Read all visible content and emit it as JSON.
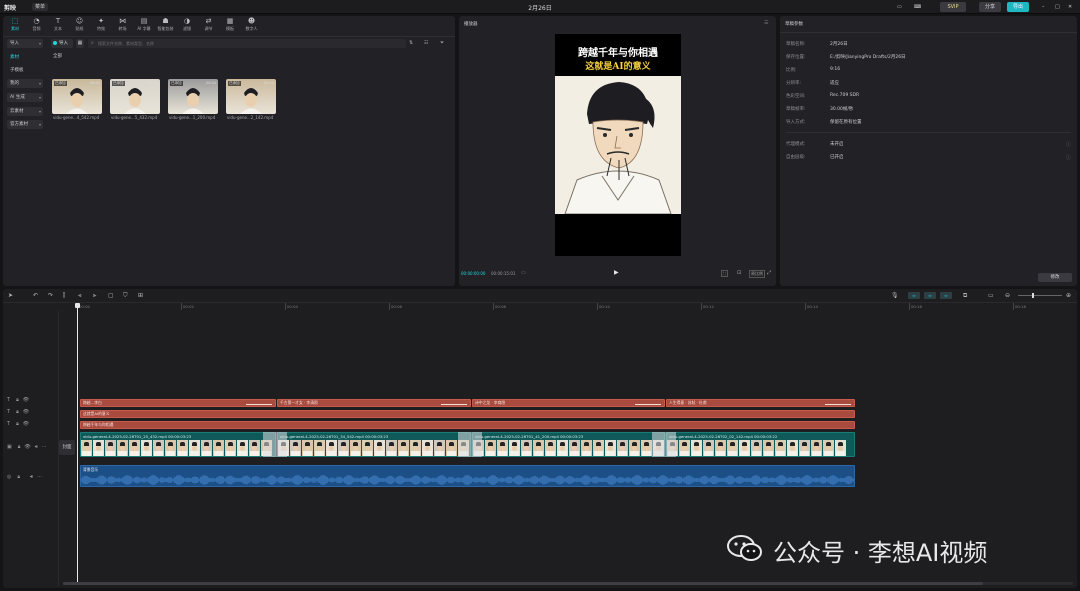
{
  "titlebar": {
    "app_name": "剪映",
    "menu_label": "菜单",
    "project_title": "2月26日",
    "vip_label": "SVIP",
    "share_label": "分享",
    "export_label": "导出"
  },
  "media": {
    "tools": [
      {
        "icon": "import-icon",
        "label": "素材"
      },
      {
        "icon": "audio-icon",
        "label": "音频"
      },
      {
        "icon": "text-icon",
        "label": "文本"
      },
      {
        "icon": "sticker-icon",
        "label": "贴纸"
      },
      {
        "icon": "effects-icon",
        "label": "特效"
      },
      {
        "icon": "transition-icon",
        "label": "转场"
      },
      {
        "icon": "ai-caption-icon",
        "label": "AI 字幕"
      },
      {
        "icon": "smart-package-icon",
        "label": "智能包装"
      },
      {
        "icon": "filter-icon",
        "label": "滤镜"
      },
      {
        "icon": "adjust-icon",
        "label": "调节"
      },
      {
        "icon": "template-icon",
        "label": "模板"
      },
      {
        "icon": "digital-human-icon",
        "label": "数字人"
      }
    ],
    "sidebar": [
      {
        "label": "导入",
        "caret": true,
        "sel": false
      },
      {
        "label": "素材",
        "caret": false,
        "sel": true
      },
      {
        "label": "子模板",
        "caret": false,
        "sel": false
      },
      {
        "label": "我的",
        "caret": true,
        "sel": false
      },
      {
        "label": "AI 生成",
        "caret": true,
        "sel": false
      },
      {
        "label": "云素材",
        "caret": true,
        "sel": false
      },
      {
        "label": "官方素材",
        "caret": true,
        "sel": false
      }
    ],
    "import_label": "导入",
    "search_placeholder": "搜索文件名称、素材类型、名称",
    "filter_all": "全部",
    "items": [
      {
        "badge": "已添加",
        "duration": "00:04",
        "name": "vidu-gene...4_542.mp4",
        "tone": "#c8b89a"
      },
      {
        "badge": "已添加",
        "duration": "00:04",
        "name": "vidu-gene...5_432.mp4",
        "tone": "#d9d4cc"
      },
      {
        "badge": "已添加",
        "duration": "00:04",
        "name": "vidu-gene...1_200.mp4",
        "tone": "#9b9b9b"
      },
      {
        "badge": "已添加",
        "duration": "00:04",
        "name": "vidu-gene...2_142.mp4",
        "tone": "#cbb99c"
      }
    ]
  },
  "player": {
    "header": "播放器",
    "caption_line1": "跨越千年与你相遇",
    "caption_line2": "这就是AI的意义",
    "current_time": "00:00:00:00",
    "total_time": "00:00:15:01",
    "ratio_btn": "原比例"
  },
  "props": {
    "header": "草稿参数",
    "rows": [
      {
        "k": "草稿名称:",
        "v": "2月26日"
      },
      {
        "k": "保存位置:",
        "v": "E:/剪映/JianyingPro Drafts/2月26日"
      },
      {
        "k": "比例:",
        "v": "9:16"
      },
      {
        "k": "分辨率:",
        "v": "适应"
      },
      {
        "k": "色彩空间:",
        "v": "Rec.709 SDR"
      },
      {
        "k": "草稿帧率:",
        "v": "30.00帧/秒"
      },
      {
        "k": "导入方式:",
        "v": "保留在原有位置"
      },
      {
        "k": "代理模式:",
        "v": "未开启"
      },
      {
        "k": "自由层级:",
        "v": "已开启"
      }
    ],
    "modify_button": "修改"
  },
  "timeline": {
    "ruler": [
      "00:00",
      "00:02",
      "00:04",
      "00:06",
      "00:08",
      "00:10",
      "00:12",
      "00:14",
      "00:16",
      "00:18"
    ],
    "cover_label": "封面",
    "text_clips_row1": [
      "跨越...李白",
      "千古第一才女 · 李清照",
      "诗中之龙 · 李商隐",
      "人生得意 · 苏轼 · 杜甫"
    ],
    "text_clip_row2": "这就是AI的意义",
    "text_clip_row3": "跨越千年与你相遇",
    "video_clips": [
      "vidu-general-4-2025-02-26T01_25_432.mp4   00:00:03:23",
      "vidu-general-4-2025-02-26T01_34_542.mp4   00:00:03:23",
      "vidu-general-4-2025-02-26T01_41_200.mp4   00:00:03:23",
      "vidu-general-4-2025-02-26T02_02_142.mp4   00:00:03:22"
    ],
    "audio_label": "背景音乐"
  },
  "watermark": {
    "text": "公众号 · 李想AI视频"
  },
  "colors": {
    "accent": "#25d3dd",
    "text_clip": "#a84a3e",
    "video_clip": "#0f5a58",
    "audio_clip": "#1c4f86"
  }
}
